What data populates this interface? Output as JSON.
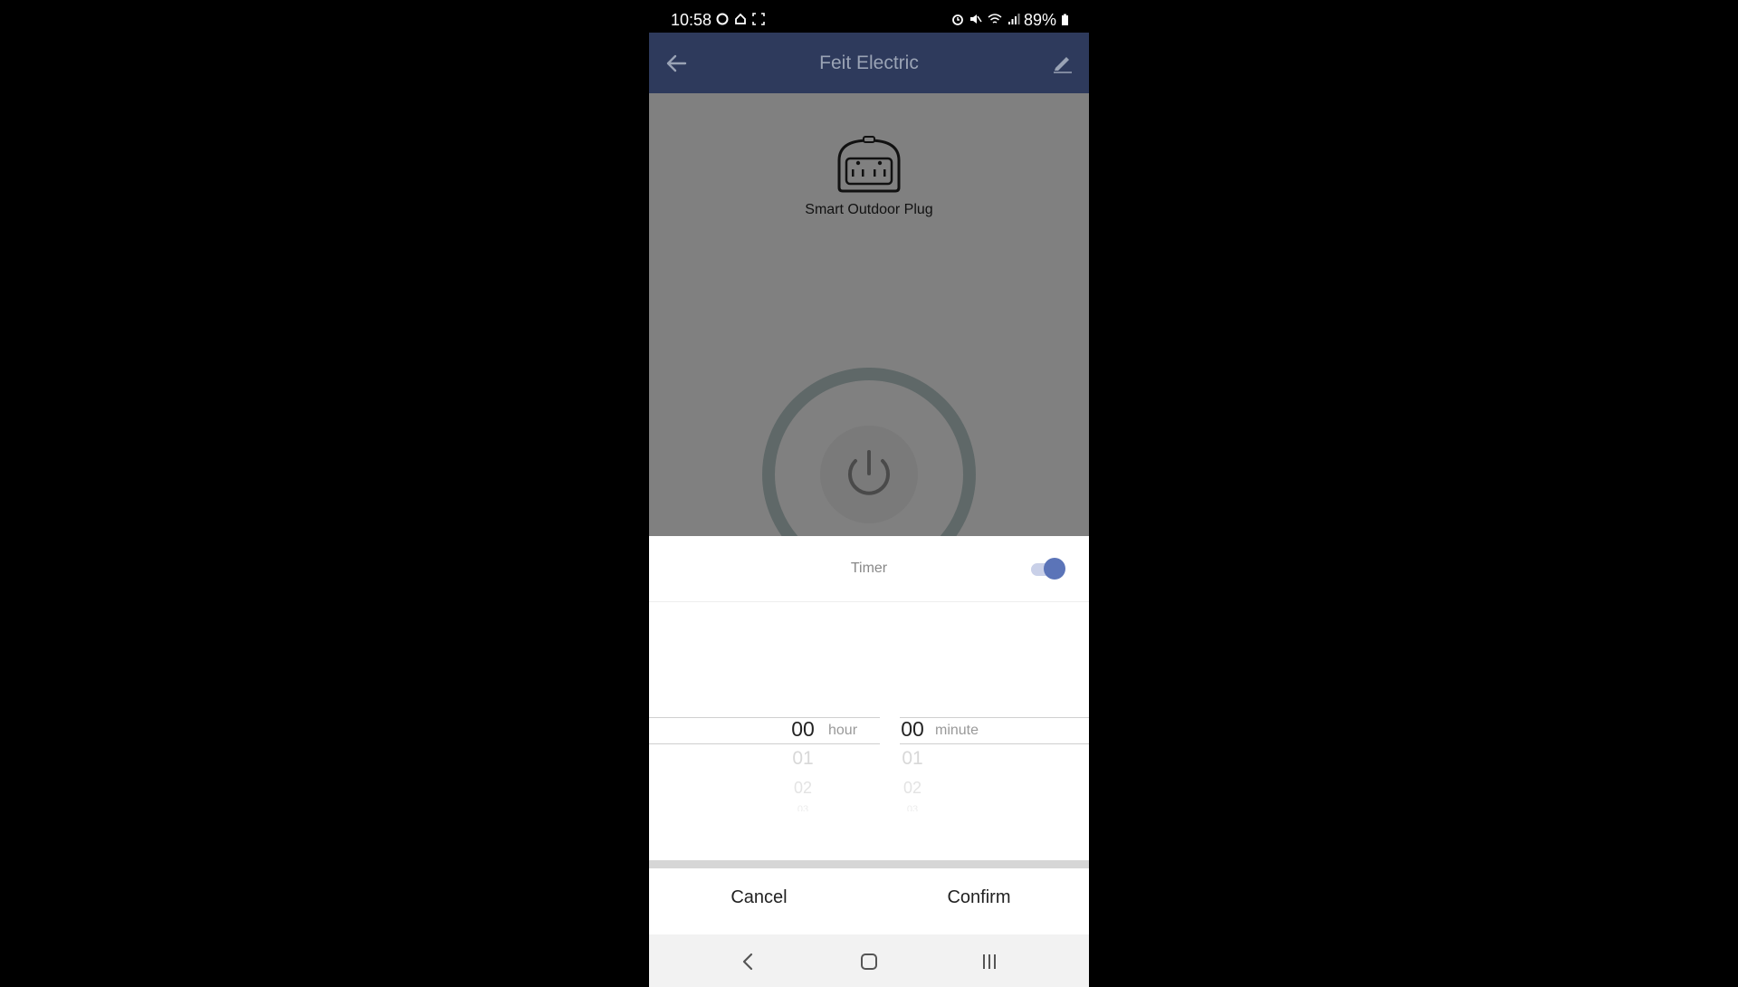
{
  "status_bar": {
    "time": "10:58",
    "battery": "89%"
  },
  "header": {
    "title": "Feit Electric",
    "back_icon": "arrow-left-icon",
    "edit_icon": "pencil-icon"
  },
  "device": {
    "name": "Smart Outdoor Plug",
    "icon": "outdoor-plug-icon",
    "power_icon": "power-icon"
  },
  "timer": {
    "label": "Timer",
    "enabled": true
  },
  "hour_picker": {
    "selected": "00",
    "unit": "hour",
    "options": [
      "01",
      "02",
      "03"
    ]
  },
  "minute_picker": {
    "selected": "00",
    "unit": "minute",
    "options": [
      "01",
      "02",
      "03"
    ]
  },
  "actions": {
    "cancel": "Cancel",
    "confirm": "Confirm"
  },
  "colors": {
    "header_bg": "#2e3a5c",
    "accent": "#5b74b8",
    "overlay": "#808080"
  }
}
